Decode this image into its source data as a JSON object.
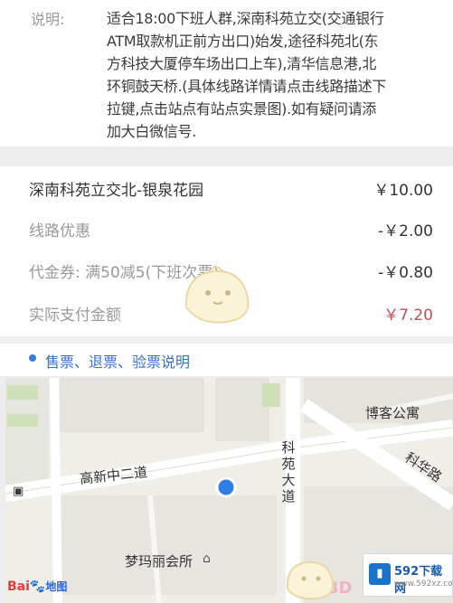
{
  "description": {
    "label": "说明:",
    "lines": [
      "适合18:00下班人群,深南科苑立交(交通银行",
      "ATM取款机正前方出口)始发,途径科苑北(东",
      "方科技大厦停车场出口上车),清华信息港,北",
      "环铜鼓天桥.(具体线路详情请点击线路描述下",
      "拉键,点击站点有站点实景图).如有疑问请添",
      "加大白微信号."
    ]
  },
  "pricing": {
    "route": {
      "label": "深南科苑立交北-银泉花园",
      "value": "￥10.00"
    },
    "discount": {
      "label": "线路优惠",
      "value": "-￥2.00"
    },
    "coupon": {
      "label": "代金券: 满50减5(下班次票)",
      "value": "-￥0.80"
    },
    "actual": {
      "label": "实际支付金额",
      "value": "￥7.20"
    }
  },
  "notice": {
    "text": "售票、退票、验票说明"
  },
  "map": {
    "labels": {
      "road_gaoxin": "高新中二道",
      "road_keyuan": [
        "科",
        "苑",
        "大",
        "道"
      ],
      "road_kehua": "科华路",
      "poi_boke": "博客公寓",
      "poi_mengmali": "梦玛丽会所",
      "baidu_logo_text": "Bai",
      "baidu_logo_map": "地图",
      "watermark_3d": "3D"
    }
  },
  "badge": {
    "line1": "592下载网",
    "line2": "www.592xz.com"
  },
  "colors": {
    "accent": "#3a7be0",
    "price_total": "#c0505a",
    "road": "#ffffff"
  }
}
